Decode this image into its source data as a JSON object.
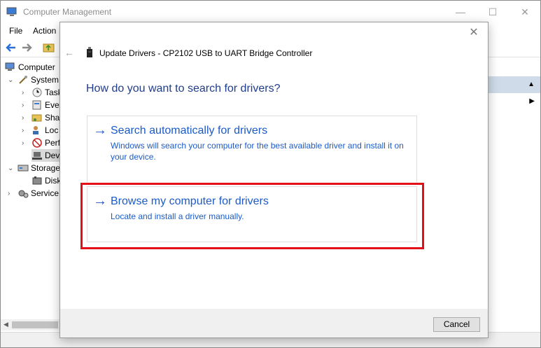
{
  "background_window": {
    "title": "Computer Management",
    "menu": [
      "File",
      "Action"
    ],
    "tree": [
      {
        "label": "Computer",
        "caret": "",
        "icon": "computer-icon"
      },
      {
        "label": "System",
        "caret": "v",
        "icon": "tools-icon"
      },
      {
        "label": "Task",
        "caret": ">",
        "icon": "clock-icon"
      },
      {
        "label": "Eve",
        "caret": ">",
        "icon": "event-viewer-icon"
      },
      {
        "label": "Sha",
        "caret": ">",
        "icon": "shared-folder-icon"
      },
      {
        "label": "Loc",
        "caret": ">",
        "icon": "users-icon"
      },
      {
        "label": "Perf",
        "caret": ">",
        "icon": "performance-icon"
      },
      {
        "label": "Dev",
        "caret": "",
        "icon": "device-manager-icon"
      },
      {
        "label": "Storage",
        "caret": "v",
        "icon": "storage-icon"
      },
      {
        "label": "Disk",
        "caret": "",
        "icon": "disk-icon"
      },
      {
        "label": "Service",
        "caret": ">",
        "icon": "services-icon"
      }
    ],
    "window_buttons": {
      "minimize": "—",
      "maximize": "☐",
      "close": "✕"
    }
  },
  "dialog": {
    "close_glyph": "✕",
    "back_glyph": "←",
    "title": "Update Drivers - CP2102 USB to UART Bridge Controller",
    "question": "How do you want to search for drivers?",
    "options": [
      {
        "arrow": "→",
        "title": "Search automatically for drivers",
        "description": "Windows will search your computer for the best available driver and install it on your device."
      },
      {
        "arrow": "→",
        "title": "Browse my computer for drivers",
        "description": "Locate and install a driver manually."
      }
    ],
    "cancel_label": "Cancel"
  },
  "colors": {
    "accent": "#1c5bc7",
    "question": "#1f3d8a",
    "highlight": "#e3101a"
  }
}
